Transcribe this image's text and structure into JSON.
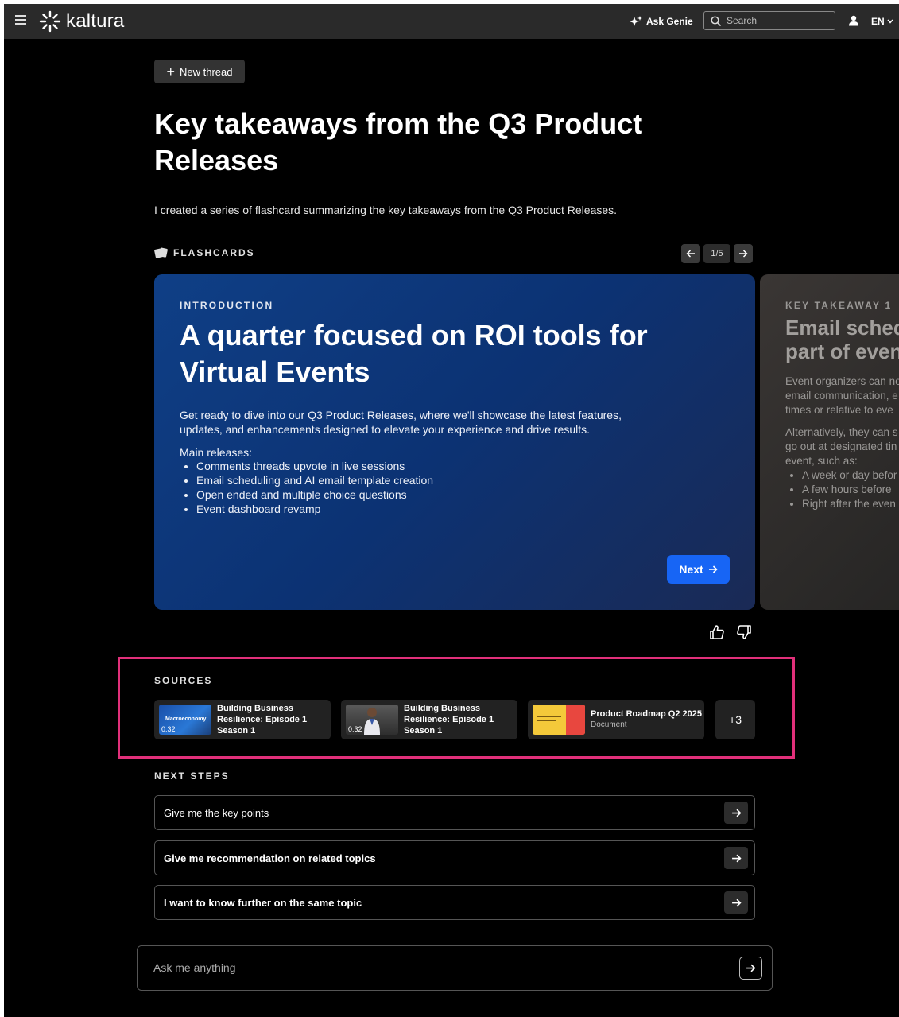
{
  "header": {
    "logo_text": "kaltura",
    "ask_genie": "Ask Genie",
    "search_placeholder": "Search",
    "language": "EN"
  },
  "thread": {
    "new_thread_label": "New thread",
    "title": "Key takeaways from the Q3 Product Releases",
    "intro": "I created a series of flashcard summarizing the key takeaways from the Q3 Product Releases."
  },
  "flashcards": {
    "label": "FLASHCARDS",
    "counter": "1/5",
    "current": {
      "eyebrow": "INTRODUCTION",
      "title": "A quarter focused on ROI tools for Virtual Events",
      "body": "Get ready to dive into our Q3 Product Releases, where we'll showcase the latest features, updates, and enhancements designed to elevate your experience and drive results.",
      "subheading": "Main releases:",
      "items": [
        "Comments threads upvote in live sessions",
        "Email scheduling and AI email template creation",
        "Open ended and multiple choice questions",
        "Event dashboard revamp"
      ],
      "next_label": "Next"
    },
    "next_card": {
      "eyebrow": "KEY TAKEAWAY 1",
      "title_line1": "Email schedu",
      "title_line2": "part of event",
      "para1_line1": "Event organizers can no",
      "para1_line2": "email communication, e",
      "para1_line3": "times or relative to eve",
      "para2_line1": "Alternatively, they can s",
      "para2_line2": "go out at designated tin",
      "para2_line3": "event, such as:",
      "items": [
        "A week or day befor",
        "A few hours before",
        "Right after the even"
      ]
    }
  },
  "sources": {
    "label": "SOURCES",
    "items": [
      {
        "title": "Building Business Resilience: Episode 1 Season 1",
        "duration": "0:32",
        "thumb_tag": "Macroeconomy"
      },
      {
        "title": "Building Business Resilience: Episode 1 Season 1",
        "duration": "0:32"
      },
      {
        "title": "Product Roadmap Q2 2025",
        "subtitle": "Document"
      }
    ],
    "more": "+3"
  },
  "next_steps": {
    "label": "NEXT STEPS",
    "items": [
      "Give me the key points",
      "Give me recommendation on related topics",
      "I want to know further on the same topic"
    ]
  },
  "ask": {
    "placeholder": "Ask me anything"
  },
  "colors": {
    "accent": "#1765f5",
    "highlight": "#e1307a",
    "card": "#0f3f86",
    "background": "#000000"
  }
}
